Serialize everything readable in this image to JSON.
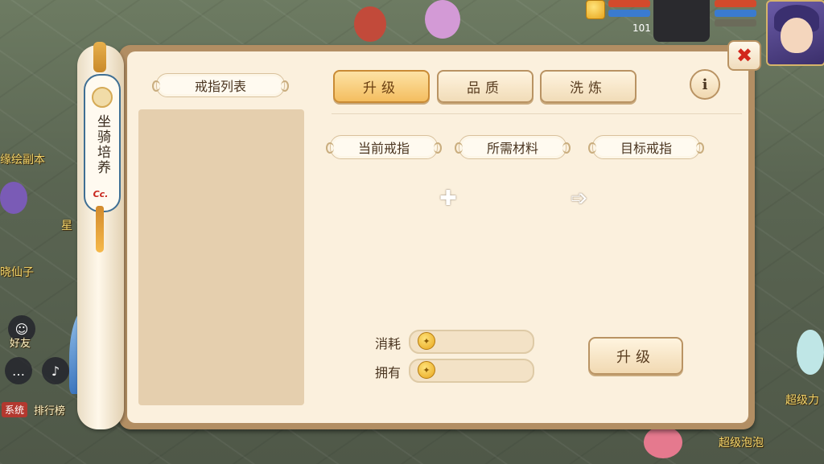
{
  "panel": {
    "spine_title": "坐骑培养",
    "spine_badge": "Cc.",
    "list_title": "戒指列表",
    "close_symbol": "✖",
    "info_symbol": "i"
  },
  "tabs": [
    {
      "label": "升级",
      "active": true
    },
    {
      "label": "品质",
      "active": false
    },
    {
      "label": "洗炼",
      "active": false
    }
  ],
  "slots": {
    "current": "当前戒指",
    "materials": "所需材料",
    "target": "目标戒指",
    "plus_symbol": "✚",
    "arrow_symbol": "➩"
  },
  "cost": {
    "consume_label": "消耗",
    "own_label": "拥有",
    "consume_value": "",
    "own_value": "",
    "coin_icon": "coin-icon"
  },
  "upgrade_button": "升级",
  "world": {
    "labels": [
      "缘绘副本",
      "星",
      "晓仙子",
      "好友",
      "排行榜",
      "超级力",
      "超级泡泡"
    ],
    "level": "101",
    "system_tag": "系统"
  },
  "colors": {
    "panel_bg": "#fbf0dd",
    "tab_active": "#f4be60",
    "close_x": "#d2261b",
    "spine_border": "#3f6f94"
  }
}
